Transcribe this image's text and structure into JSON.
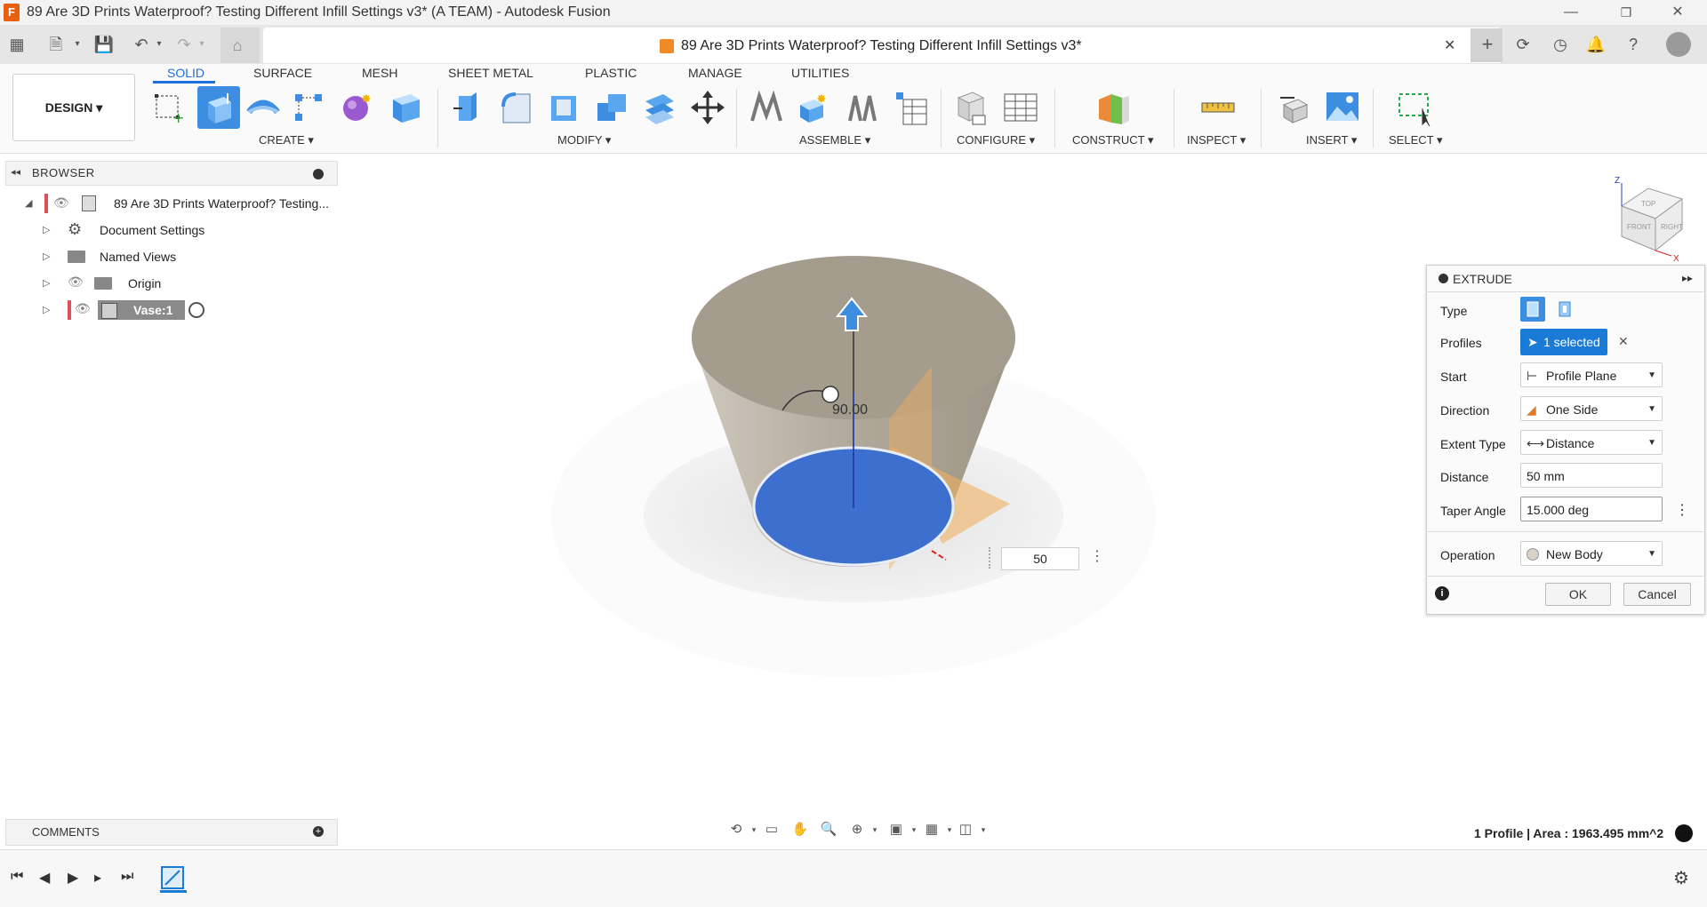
{
  "window": {
    "title": "89 Are 3D Prints Waterproof? Testing Different Infill Settings v3* (A TEAM) - Autodesk Fusion",
    "app_icon": "F"
  },
  "doc_tab": {
    "title": "89 Are 3D Prints Waterproof? Testing Different Infill Settings v3*",
    "close": "✕"
  },
  "workspace": {
    "label": "DESIGN ▾"
  },
  "tabs": [
    "SOLID",
    "SURFACE",
    "MESH",
    "SHEET METAL",
    "PLASTIC",
    "MANAGE",
    "UTILITIES"
  ],
  "groups": {
    "create": "CREATE ▾",
    "modify": "MODIFY ▾",
    "assemble": "ASSEMBLE ▾",
    "configure": "CONFIGURE ▾",
    "construct": "CONSTRUCT ▾",
    "inspect": "INSPECT ▾",
    "insert": "INSERT ▾",
    "select": "SELECT ▾"
  },
  "browser": {
    "title": "BROWSER",
    "root": "89 Are 3D Prints Waterproof? Testing...",
    "items": [
      "Document Settings",
      "Named Views",
      "Origin",
      "Vase:1"
    ]
  },
  "comments": {
    "label": "COMMENTS"
  },
  "viewport": {
    "angle_label": "90.00",
    "distance_input": "50",
    "viewcube_faces": [
      "TOP",
      "FRONT",
      "RIGHT"
    ],
    "axis_labels": [
      "Z",
      "X"
    ]
  },
  "extrude": {
    "title": "EXTRUDE",
    "rows": {
      "type": "Type",
      "profiles": "Profiles",
      "start": "Start",
      "direction": "Direction",
      "extent_type": "Extent Type",
      "distance": "Distance",
      "taper_angle": "Taper Angle",
      "operation": "Operation"
    },
    "values": {
      "profiles": "1 selected",
      "start": "Profile Plane",
      "direction": "One Side",
      "extent_type": "Distance",
      "distance": "50 mm",
      "taper_angle": "15.000 deg",
      "operation": "New Body"
    },
    "ok": "OK",
    "cancel": "Cancel"
  },
  "status": {
    "text": "1 Profile | Area : 1963.495 mm^2"
  },
  "colors": {
    "accent": "#1e6fd9",
    "profile_fill": "#3d6fcf",
    "body": "#a79e90",
    "selected_chip": "#1a7bd6"
  }
}
